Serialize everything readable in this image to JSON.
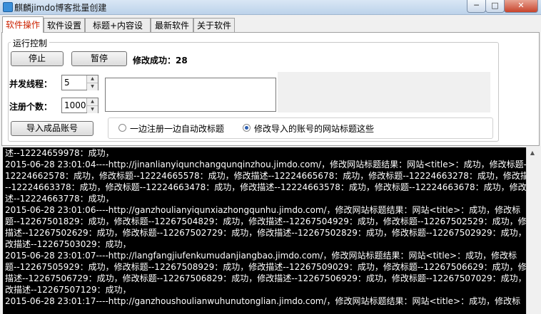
{
  "window": {
    "title": "麒麟jimdo博客批量创建",
    "min": "─",
    "max": "□",
    "close": "✕"
  },
  "tabs": [
    {
      "label": "软件操作",
      "active": true
    },
    {
      "label": "软件设置",
      "active": false
    },
    {
      "label": "标题+内容设置",
      "active": false
    },
    {
      "label": "最新软件",
      "active": false
    },
    {
      "label": "关于软件",
      "active": false
    }
  ],
  "control": {
    "group_label": "运行控制",
    "stop_button": "停止",
    "pause_button": "暂停",
    "success_label": "修改成功：28",
    "threads_label": "并发线程：",
    "threads_value": "5",
    "count_label": "注册个数：",
    "count_value": "1000",
    "import_button": "导入成品账号",
    "radio_options": [
      {
        "label": "一边注册一边自动改标题",
        "selected": false
      },
      {
        "label": "修改导入的账号的网站标题这些",
        "selected": true
      }
    ]
  },
  "log": [
    "述--12224659978：成功，",
    "2015-06-28 23:01:04----http://jinanlianyiqunchangqunqinzhou.jimdo.com/，修改网站标题结果：网站<title>：成功，修改标题--",
    "12224662578：成功，修改标题--12224665578：成功，修改描述--12224665678：成功，修改标题--12224663278：成功，修改描述",
    "--12224663378：成功，修改标题--12224663478：成功，修改描述--12224663578：成功，修改标题--12224663678：成功，修改描",
    "述--12224663778：成功，",
    "2015-06-28 23:01:06----http://ganzhoulianyiqunxiazhongqunhu.jimdo.com/，修改网站标题结果：网站<title>：成功，修改标",
    "题--12267501829：成功，修改标题--12267504829：成功，修改描述--12267504929：成功，修改标题--12267502529：成功，修改",
    "描述--12267502629：成功，修改标题--12267502729：成功，修改描述--12267502829：成功，修改标题--12267502929：成功，修",
    "改描述--12267503029：成功，",
    "2015-06-28 23:01:07----http://langfangjiufenkumudanjiangbao.jimdo.com/，修改网站标题结果：网站<title>：成功，修改标",
    "题--12267505929：成功，修改标题--12267508929：成功，修改描述--12267509029：成功，修改标题--12267506629：成功，修改",
    "描述--12267506729：成功，修改标题--12267506829：成功，修改描述--12267506929：成功，修改标题--12267507029：成功，修",
    "改描述--12267507129：成功，",
    "2015-06-28 23:01:17----http://ganzhoushoulianwuhunutonglian.jimdo.com/，修改网站标题结果：网站<title>：成功，修改标"
  ]
}
